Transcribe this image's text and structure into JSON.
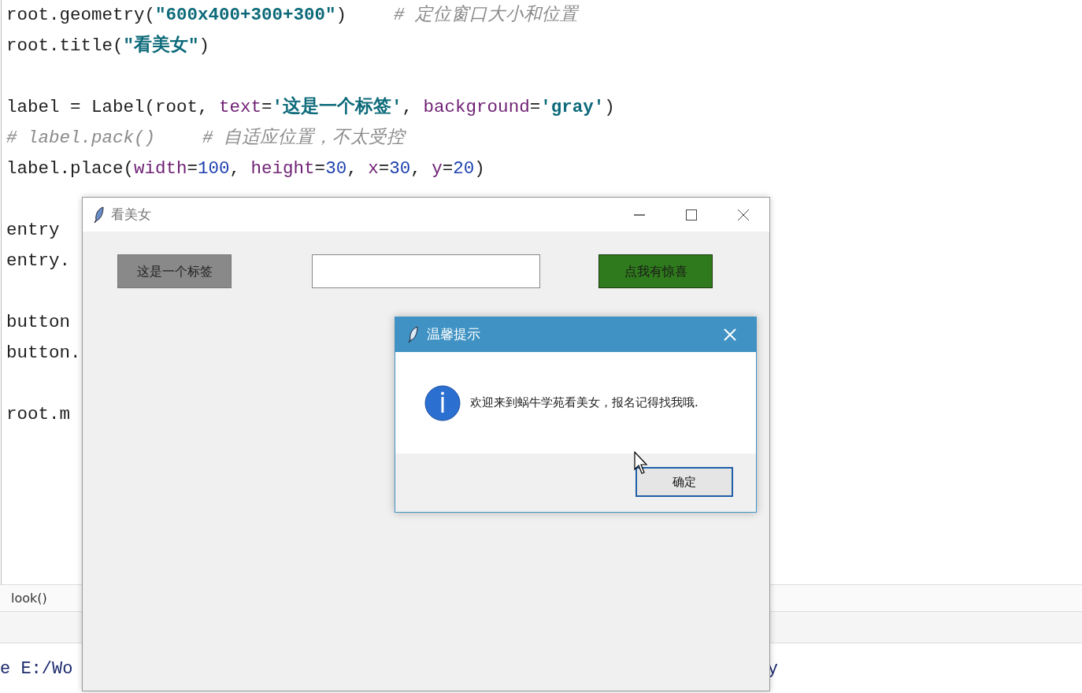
{
  "editor": {
    "blocks": [
      [
        [
          {
            "kind": "plain",
            "text": "root.geometry("
          },
          {
            "kind": "string",
            "text": "\"600x400+300+300\""
          },
          {
            "kind": "plain",
            "text": ")"
          },
          {
            "kind": "comment",
            "text": "# 定位窗口大小和位置"
          }
        ],
        [
          {
            "kind": "plain",
            "text": "root.title("
          },
          {
            "kind": "string",
            "text": "\"看美女\""
          },
          {
            "kind": "plain",
            "text": ")"
          }
        ]
      ],
      [
        [
          {
            "kind": "plain",
            "text": "label = Label(root, "
          },
          {
            "kind": "param",
            "text": "text"
          },
          {
            "kind": "plain",
            "text": "="
          },
          {
            "kind": "string",
            "text": "'这是一个标签'"
          },
          {
            "kind": "plain",
            "text": ", "
          },
          {
            "kind": "param",
            "text": "background"
          },
          {
            "kind": "plain",
            "text": "="
          },
          {
            "kind": "string",
            "text": "'gray'"
          },
          {
            "kind": "plain",
            "text": ")"
          }
        ],
        [
          {
            "kind": "comment",
            "text": "# label.pack()"
          },
          {
            "kind": "comment",
            "text": "# 自适应位置，不太受控"
          }
        ],
        [
          {
            "kind": "plain",
            "text": "label.place("
          },
          {
            "kind": "param",
            "text": "width"
          },
          {
            "kind": "plain",
            "text": "="
          },
          {
            "kind": "number",
            "text": "100"
          },
          {
            "kind": "plain",
            "text": ", "
          },
          {
            "kind": "param",
            "text": "height"
          },
          {
            "kind": "plain",
            "text": "="
          },
          {
            "kind": "number",
            "text": "30"
          },
          {
            "kind": "plain",
            "text": ", "
          },
          {
            "kind": "param",
            "text": "x"
          },
          {
            "kind": "plain",
            "text": "="
          },
          {
            "kind": "number",
            "text": "30"
          },
          {
            "kind": "plain",
            "text": ", "
          },
          {
            "kind": "param",
            "text": "y"
          },
          {
            "kind": "plain",
            "text": "="
          },
          {
            "kind": "number",
            "text": "20"
          },
          {
            "kind": "plain",
            "text": ")"
          }
        ]
      ],
      [
        [
          {
            "kind": "plain",
            "text": "entry"
          }
        ],
        [
          {
            "kind": "plain",
            "text": "entry."
          }
        ]
      ],
      [
        [
          {
            "kind": "plain",
            "text": "button"
          }
        ],
        [
          {
            "kind": "plain",
            "text": "button."
          }
        ]
      ],
      [
        [
          {
            "kind": "plain",
            "text": "root.m"
          }
        ]
      ]
    ]
  },
  "panel": {
    "tab": "look()"
  },
  "console": {
    "left": "e E:/Wo",
    "right": "y"
  },
  "tk_window": {
    "title": "看美女",
    "label": "这是一个标签",
    "button": "点我有惊喜"
  },
  "dialog": {
    "title": "温馨提示",
    "message": "欢迎来到蜗牛学苑看美女，报名记得找我哦.",
    "ok_button": "确定"
  }
}
